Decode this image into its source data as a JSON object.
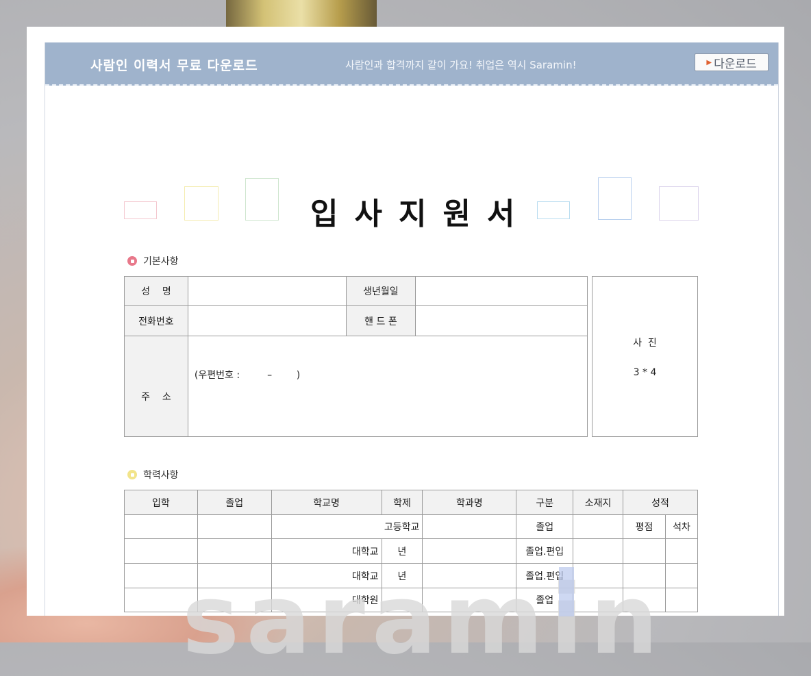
{
  "banner": {
    "title": "사람인 이력서 무료 다운로드",
    "slogan": "사람인과 합격까지 같이 가요! 취업은 역시 Saramin!",
    "download_label": "다운로드"
  },
  "document": {
    "title": "입사지원서",
    "basic_section": "기본사항",
    "basic": {
      "name_label": "성    명",
      "birth_label": "생년월일",
      "phone_label": "전화번호",
      "mobile_label": "핸 드 폰",
      "address_label": "주    소",
      "postal_text": "(우편번호 :         –        )",
      "photo_label": "사  진",
      "photo_size": "3 * 4"
    },
    "education_section": "학력사항",
    "education": {
      "headers": [
        "입학",
        "졸업",
        "학교명",
        "학제",
        "학과명",
        "구분",
        "소재지",
        "성적"
      ],
      "grade_sub": [
        "평점",
        "석차"
      ],
      "rows": [
        {
          "school": "고등학교",
          "system": "",
          "division": "졸업"
        },
        {
          "school": "대학교",
          "system": "년",
          "division": "졸업.편입"
        },
        {
          "school": "대학교",
          "system": "년",
          "division": "졸업.편입"
        },
        {
          "school": "대학원",
          "system": "",
          "division": "졸업"
        }
      ]
    },
    "watermark": "saramin"
  },
  "colors": {
    "banner_bg": "#9fb3cc",
    "bullet_basic": "#e8788a",
    "bullet_education": "#f2e48a",
    "label_bg": "#f2f2f2"
  }
}
